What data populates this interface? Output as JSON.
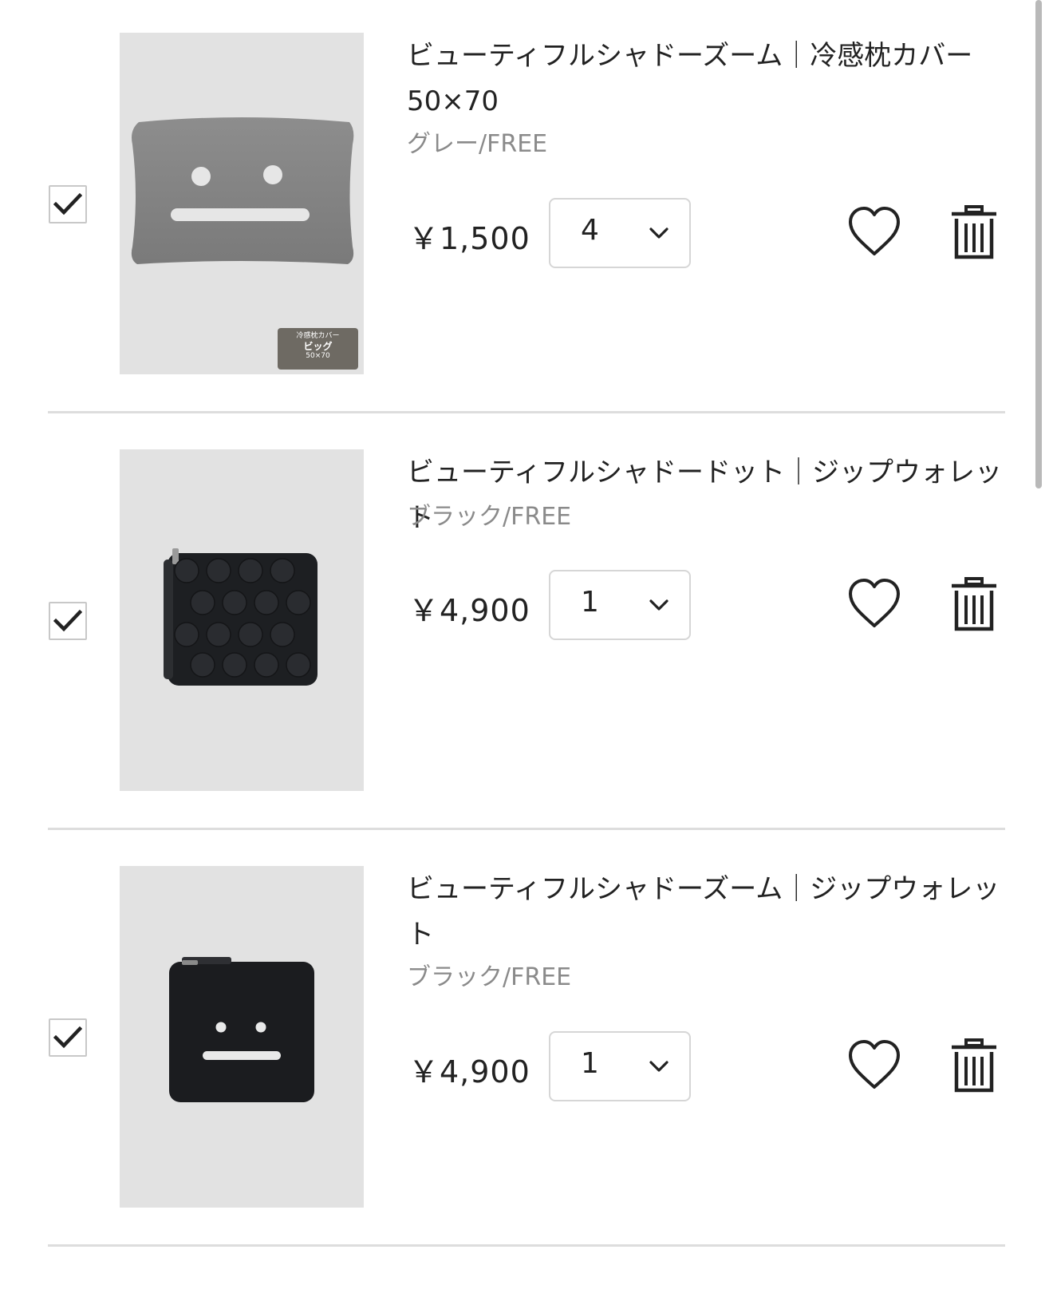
{
  "items": [
    {
      "checked": true,
      "title": "ビューティフルシャドーズーム｜冷感枕カバー 50×70",
      "variant": "グレー/FREE",
      "price": "￥1,500",
      "quantity": "4",
      "image_icon": "pillow-cover-product-image",
      "badge": {
        "line1": "冷感枕カバー",
        "line2": "ビッグ",
        "line3": "50×70"
      }
    },
    {
      "checked": true,
      "title": "ビューティフルシャドードット｜ジップウォレット",
      "variant": "ブラック/FREE",
      "price": "￥4,900",
      "quantity": "1",
      "image_icon": "dot-zip-wallet-product-image"
    },
    {
      "checked": true,
      "title": "ビューティフルシャドーズーム｜ジップウォレット",
      "variant": "ブラック/FREE",
      "price": "￥4,900",
      "quantity": "1",
      "image_icon": "face-zip-wallet-product-image"
    }
  ],
  "icons": {
    "checkbox": "checkmark-icon",
    "quantity": "chevron-down-icon",
    "favorite": "heart-icon",
    "delete": "trash-icon"
  },
  "colors": {
    "text": "#222222",
    "muted": "#8a8a8a",
    "border": "#d6d6d6",
    "divider": "#dddddd",
    "thumb_bg": "#e2e2e2"
  }
}
